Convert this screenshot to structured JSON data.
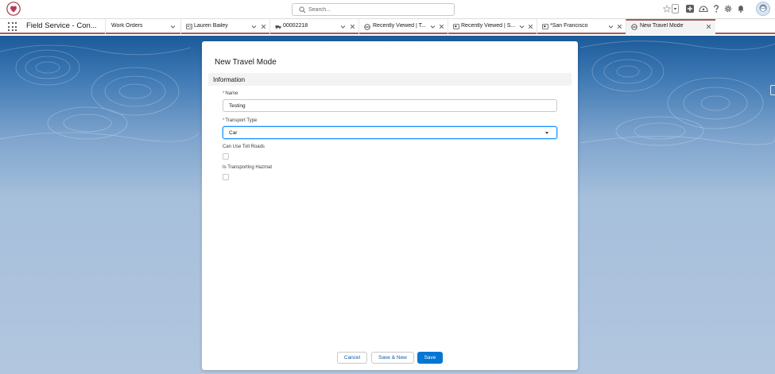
{
  "header": {
    "search_placeholder": "Search...",
    "icons": [
      "favorites-star-icon",
      "favorites-dropdown-icon",
      "global-add-icon",
      "trailhead-icon",
      "help-icon",
      "setup-gear-icon",
      "notifications-bell-icon",
      "user-avatar"
    ]
  },
  "nav": {
    "app_name": "Field Service - Con...",
    "tabs": [
      {
        "label": "Work Orders",
        "icon": "none"
      },
      {
        "label": "Lauren Bailey",
        "icon": "contact-card-icon"
      },
      {
        "label": "00002218",
        "icon": "truck-icon"
      },
      {
        "label": "Recently Viewed | T...",
        "icon": "steering-wheel-icon"
      },
      {
        "label": "Recently Viewed | S...",
        "icon": "service-territory-icon"
      },
      {
        "label": "*San Francisco",
        "icon": "service-territory-icon"
      },
      {
        "label": "New Travel Mode",
        "icon": "steering-wheel-icon"
      }
    ]
  },
  "modal": {
    "title": "New Travel Mode",
    "section": "Information",
    "fields": {
      "name": {
        "label": "Name",
        "value": "Testing",
        "required": true
      },
      "transport_type": {
        "label": "Transport Type",
        "value": "Car",
        "required": true
      },
      "toll_roads": {
        "label": "Can Use Toll Roads",
        "checked": false
      },
      "hazmat": {
        "label": "Is Transporting Hazmat",
        "checked": false
      }
    },
    "buttons": {
      "cancel": "Cancel",
      "save_new": "Save & New",
      "save": "Save"
    }
  },
  "colors": {
    "brand_blue": "#0176d3",
    "nav_accent": "#a35a5a",
    "required_red": "#c23934"
  }
}
